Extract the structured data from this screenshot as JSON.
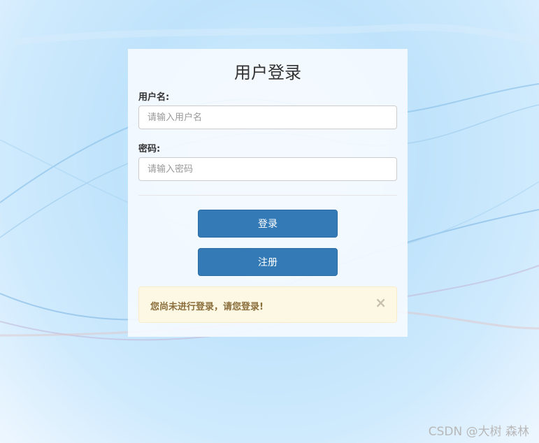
{
  "login": {
    "title": "用户登录",
    "username_label": "用户名:",
    "username_placeholder": "请输入用户名",
    "username_value": "",
    "password_label": "密码:",
    "password_placeholder": "请输入密码",
    "password_value": "",
    "login_button": "登录",
    "register_button": "注册",
    "alert_message": "您尚未进行登录，请您登录!",
    "alert_close": "×"
  },
  "watermark": "CSDN @大树 森林",
  "colors": {
    "primary_button": "#337ab7",
    "alert_background": "#fcf8e3",
    "alert_text": "#8a6d3b"
  },
  "icons": {
    "alert_close": "close-icon"
  }
}
